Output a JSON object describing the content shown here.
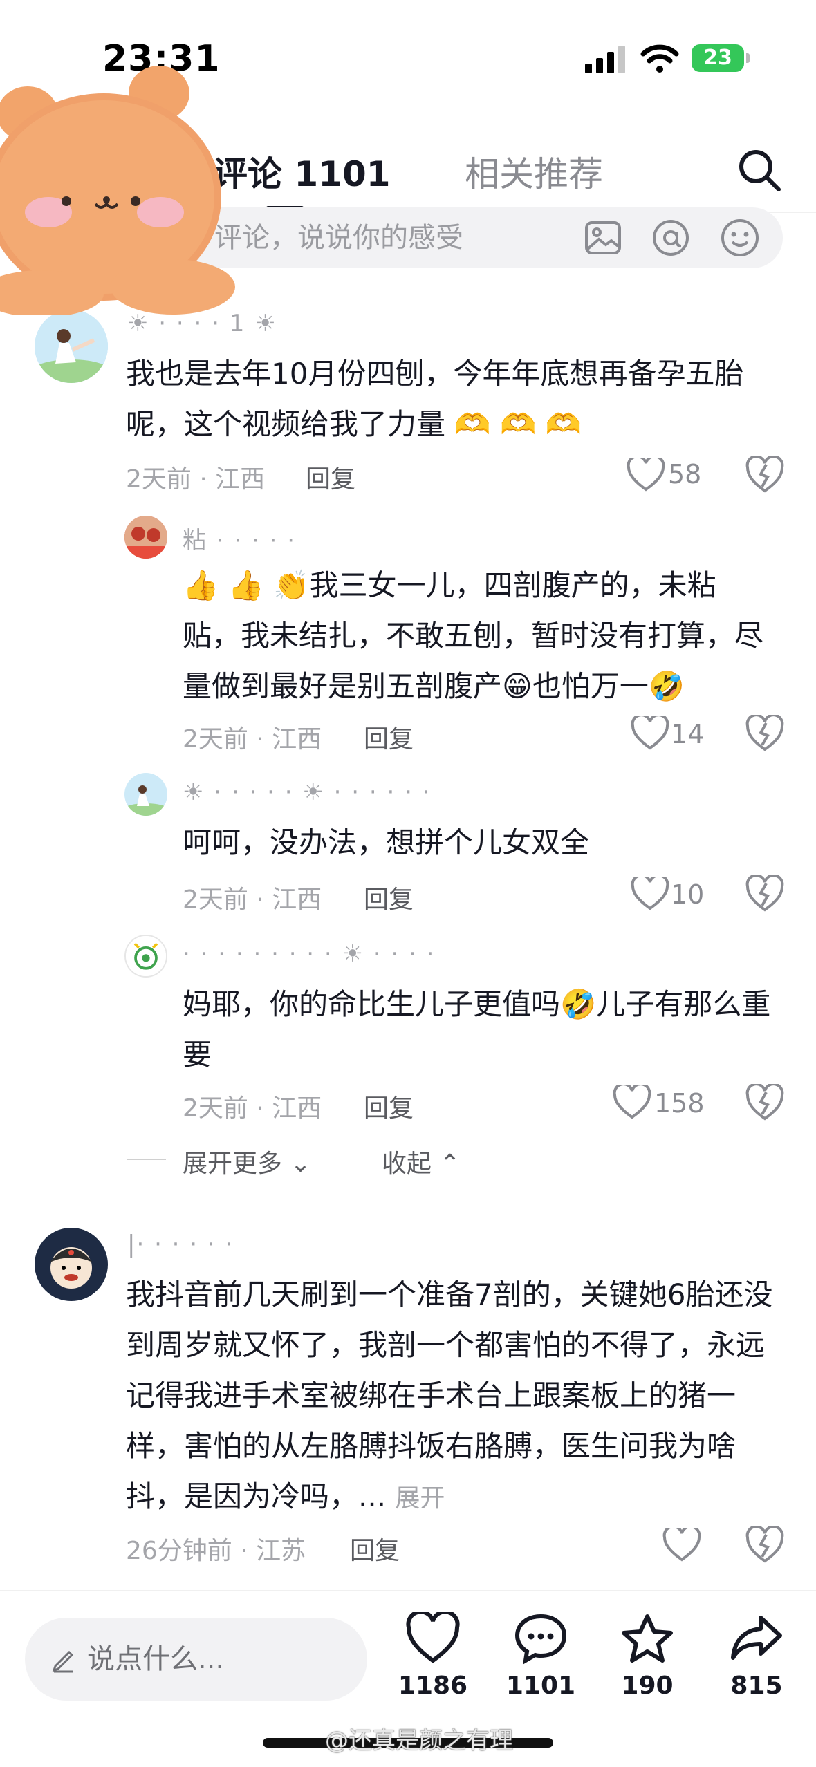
{
  "status_bar": {
    "time": "23:31",
    "battery": "23"
  },
  "tabs": {
    "comments": "评论 1101",
    "related": "相关推荐"
  },
  "comment_input": {
    "placeholder": "评论，说说你的感受"
  },
  "comments": [
    {
      "text": "我也是去年10月份四刨，今年年底想再备孕五胎呢，这个视频给我了力量",
      "meta": "2天前 · 江西",
      "reply": "回复",
      "likes": "58",
      "replies": [
        {
          "text": "我三女一儿，四剖腹产的，未粘贴，我未结扎，不敢五刨，暂时没有打算，尽量做到最好是别五剖腹产",
          "text_tail": "也怕万一",
          "meta": "2天前 · 江西",
          "reply": "回复",
          "likes": "14"
        },
        {
          "text": "呵呵，没办法，想拼个儿女双全",
          "meta": "2天前 · 江西",
          "reply": "回复",
          "likes": "10"
        },
        {
          "text": "妈耶，你的命比生儿子更值吗",
          "text_tail": "儿子有那么重要",
          "meta": "2天前 · 江西",
          "reply": "回复",
          "likes": "158"
        }
      ],
      "expand_more": "展开更多",
      "collapse": "收起"
    },
    {
      "text": "我抖音前几天刷到一个准备7剖的，关键她6胎还没到周岁就又怀了，我剖一个都害怕的不得了，永远记得我进手术室被绑在手术台上跟案板上的猪一样，害怕的从左胳膊抖饭右胳膊，医生问我为啥抖，是因为冷吗，...",
      "expand": "展开",
      "meta": "26分钟前 · 江苏",
      "reply": "回复"
    }
  ],
  "bottom_bar": {
    "say_placeholder": "说点什么...",
    "likes": "1186",
    "comments": "1101",
    "favorites": "190",
    "shares": "815"
  },
  "watermark": "@还真是颜之有理",
  "colors": {
    "accent_like": "#161823",
    "muted": "#a4a5aa",
    "battery": "#34c759"
  }
}
